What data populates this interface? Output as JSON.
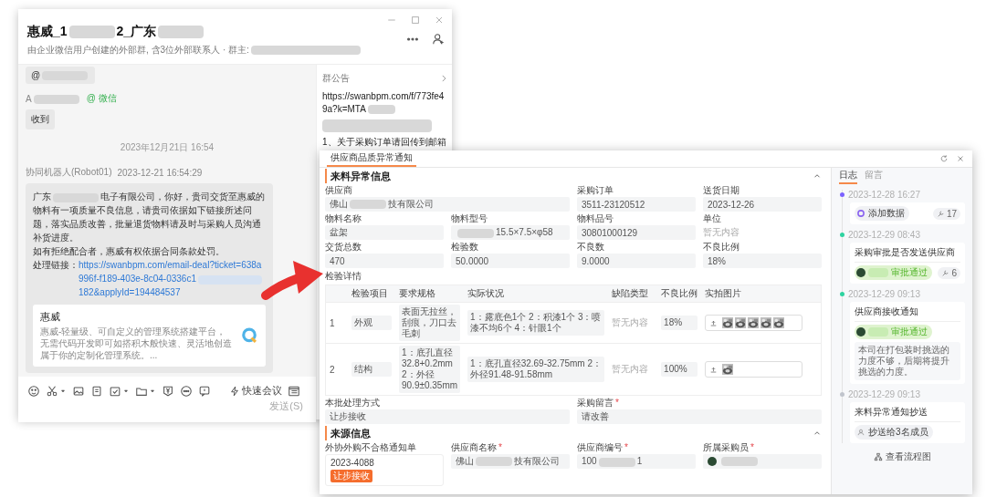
{
  "chat_window": {
    "title": {
      "parts": [
        "惠威_1",
        {
          "kind": "redacted"
        },
        "2_广东",
        {
          "kind": "redacted"
        }
      ]
    },
    "subtitle": {
      "parts": [
        "由企业微信用户创建的外部群, 含3位外部联系人 · 群主:",
        {
          "kind": "redacted"
        }
      ]
    },
    "messages": [
      {
        "kind": "bubble",
        "text": {
          "parts": [
            "@",
            {
              "kind": "redacted"
            }
          ]
        }
      },
      {
        "kind": "sender",
        "name": {
          "parts": [
            "A",
            {
              "kind": "redacted"
            }
          ]
        },
        "source": "@ 微信"
      },
      {
        "kind": "bubble",
        "text": "收到"
      },
      {
        "kind": "timestamp",
        "text": "2023年12月21日 16:54"
      },
      {
        "kind": "sender",
        "name": "协同机器人(Robot01)",
        "time": "2023-12-21 16:54:29"
      },
      {
        "kind": "notice",
        "paragraphs": [
          {
            "parts": [
              "广东",
              {
                "kind": "redacted"
              },
              "电子有限公司，你好，贵司交货至惠威的物料有一项质量不良信息，请贵司依据如下链接所述问题，落实品质改善，批量退货物料请及时与采购人员沟通补货进度。"
            ]
          },
          "如有拒绝配合者，惠威有权依据合同条款处罚。"
        ],
        "link_label": "处理链接：",
        "link": {
          "parts": [
            "https://swanbpm.com/email-deal?ticket=638a996f-f189-403e-8c04-0336c1",
            {
              "kind": "redacted"
            },
            "182&applyId=194484537"
          ]
        },
        "card": {
          "title": "惠威",
          "description": "惠威-轻量级、可自定义的管理系统搭建平台，无需代码开发即可如搭积木般快速、灵活地创造属于你的定制化管理系统。..."
        }
      }
    ],
    "meeting_button": "快速会议",
    "send_button": {
      "label": "发送(S)",
      "disabled": true
    },
    "announcement": {
      "title": "群公告",
      "link": {
        "parts": [
          "https://swanbpm.com/f/773fe49a?k=MTA",
          {
            "kind": "redacted"
          }
        ]
      },
      "redacted_line": true,
      "text": "1、关于采购订单请回传到邮箱"
    }
  },
  "form_window": {
    "tabs": [
      {
        "label": "供应商品质异常通知",
        "selected": true
      }
    ],
    "sections": [
      {
        "title": "来料异常信息",
        "expanded": true,
        "fields": [
          {
            "label": "供应商",
            "kind": "input",
            "wide": true,
            "value": {
              "parts": [
                "佛山",
                {
                  "kind": "redacted"
                },
                "技有限公司"
              ]
            }
          },
          {
            "label": "采购订单",
            "kind": "input",
            "value": "3511-23120512"
          },
          {
            "label": "送货日期",
            "kind": "input",
            "value": "2023-12-26"
          },
          {
            "label": "物料名称",
            "kind": "input",
            "value": "盆架"
          },
          {
            "label": "物料型号",
            "kind": "input",
            "value": {
              "parts": [
                {
                  "kind": "redacted"
                },
                "15.5×7.5×φ58"
              ]
            }
          },
          {
            "label": "物料品号",
            "kind": "input",
            "value": "30801000129"
          },
          {
            "label": "单位",
            "kind": "empty",
            "value": "暂无内容"
          },
          {
            "label": "交货总数",
            "kind": "input",
            "value": "470"
          },
          {
            "label": "检验数",
            "kind": "input",
            "value": "50.0000"
          },
          {
            "label": "不良数",
            "kind": "input",
            "value": "9.0000"
          },
          {
            "label": "不良比例",
            "kind": "input",
            "value": "18%"
          }
        ],
        "table": {
          "title": "检验详情",
          "columns": [
            "检验项目",
            "要求规格",
            "实际状况",
            "缺陷类型",
            "不良比例",
            "实拍图片"
          ],
          "rows": [
            {
              "number": "1",
              "item": "外观",
              "requirement": "表面无拉丝，刮痕，刀口去毛刺",
              "actual": "1：露底色1个 2：积漆1个 3：喷漆不均6个 4：针眼1个",
              "defect_type": "暂无内容",
              "ratio": "18%"
            },
            {
              "number": "2",
              "item": "结构",
              "requirement": "1：底孔直径32.8+0.2mm 2：外径90.9±0.35mm",
              "actual": "1：底孔直径32.69-32.75mm 2：外径91.48-91.58mm",
              "defect_type": "暂无内容",
              "ratio": "100%"
            }
          ]
        },
        "after_fields": [
          {
            "label": "本批处理方式",
            "kind": "input",
            "wide": true,
            "value": "让步接收"
          },
          {
            "label": "采购留言",
            "required_mark": "*",
            "kind": "input",
            "wide": true,
            "value": "请改善"
          }
        ]
      },
      {
        "title": "来源信息",
        "expanded": true,
        "fields": [
          {
            "label": "外协外购不合格通知单",
            "kind": "card",
            "value": "2023-4088",
            "tag": "让步接收"
          },
          {
            "label": "供应商名称",
            "required_mark": "*",
            "kind": "input",
            "value": {
              "parts": [
                "佛山",
                {
                  "kind": "redacted"
                },
                "技有限公司"
              ]
            }
          },
          {
            "label": "供应商编号",
            "required_mark": "*",
            "kind": "input",
            "value": {
              "parts": [
                "100",
                {
                  "kind": "redacted"
                },
                "1"
              ]
            }
          },
          {
            "label": "所属采购员",
            "required_mark": "*",
            "kind": "person"
          }
        ]
      }
    ],
    "side_tabs": [
      {
        "label": "日志",
        "selected": true
      },
      {
        "label": "留言",
        "selected": false
      }
    ],
    "events": [
      {
        "time": "2023-12-28 16:27",
        "color": "#7b61ff",
        "chip": {
          "kind": "action",
          "text": "添加数据"
        },
        "count": "17"
      },
      {
        "time": "2023-12-29 08:43",
        "color": "#2ed3a0",
        "title": "采购审批是否发送供应商",
        "chip": {
          "kind": "approval",
          "text": "审批通过"
        },
        "count": "6"
      },
      {
        "time": "2023-12-29 09:13",
        "color": "#2ed3a0",
        "title": "供应商接收通知",
        "chip": {
          "kind": "approval",
          "text": "审批通过"
        },
        "comment": "本司在打包装时挑选的力度不够，后期将提升挑选的力度。"
      },
      {
        "time": "2023-12-29 09:13",
        "color": "#c0c4cc",
        "title": "来料异常通知抄送",
        "chip": {
          "kind": "cc",
          "text": "抄送给3名成员"
        }
      }
    ],
    "flow_link": "查看流程图"
  }
}
